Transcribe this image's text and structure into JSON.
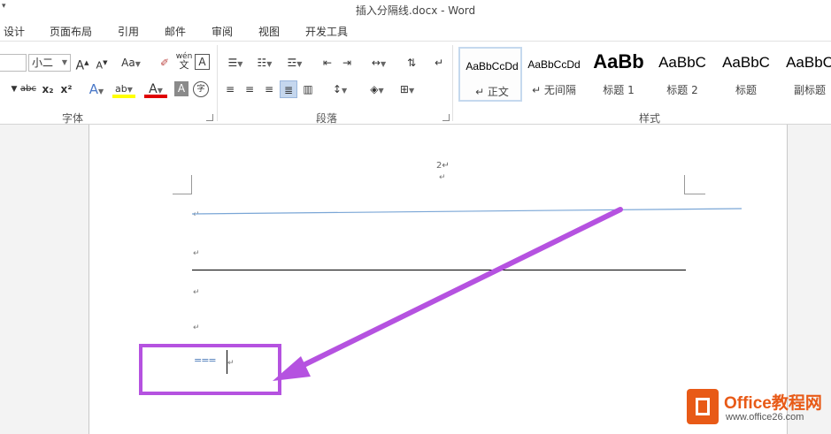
{
  "window": {
    "title": "插入分隔线.docx - Word",
    "quick_access": "▾"
  },
  "tabs": [
    {
      "label": "设计"
    },
    {
      "label": "页面布局"
    },
    {
      "label": "引用"
    },
    {
      "label": "邮件"
    },
    {
      "label": "审阅"
    },
    {
      "label": "视图"
    },
    {
      "label": "开发工具"
    }
  ],
  "font_group": {
    "label": "字体",
    "font_size": "小二",
    "grow_glyph": "A",
    "shrink_glyph": "A",
    "case_label": "Aa",
    "phonetic_top": "wén",
    "phonetic_bottom": "文",
    "border_char": "A",
    "strike_label": "abc",
    "subscript_label": "x₂",
    "superscript_label": "x²",
    "effects_glyph": "A",
    "highlight_glyph": "ab",
    "font_color_glyph": "A",
    "shade_glyph": "A",
    "enclose_glyph": "字"
  },
  "paragraph_group": {
    "label": "段落"
  },
  "styles_group": {
    "label": "样式",
    "items": [
      {
        "sample": "AaBbCcDd",
        "name": "↵ 正文"
      },
      {
        "sample": "AaBbCcDd",
        "name": "↵ 无间隔"
      },
      {
        "sample": "AaBb",
        "name": "标题 1"
      },
      {
        "sample": "AaBbC",
        "name": "标题 2"
      },
      {
        "sample": "AaBbC",
        "name": "标题"
      },
      {
        "sample": "AaBbC",
        "name": "副标题"
      }
    ]
  },
  "document": {
    "page_number": "2↵",
    "para_mark": "↵",
    "typed_text": "===",
    "cursor_mark": "↵"
  },
  "colors": {
    "annotation": "#b552e0",
    "blue_line": "#7aa6d6"
  },
  "watermark": {
    "title": "Office教程网",
    "url": "www.office26.com"
  }
}
